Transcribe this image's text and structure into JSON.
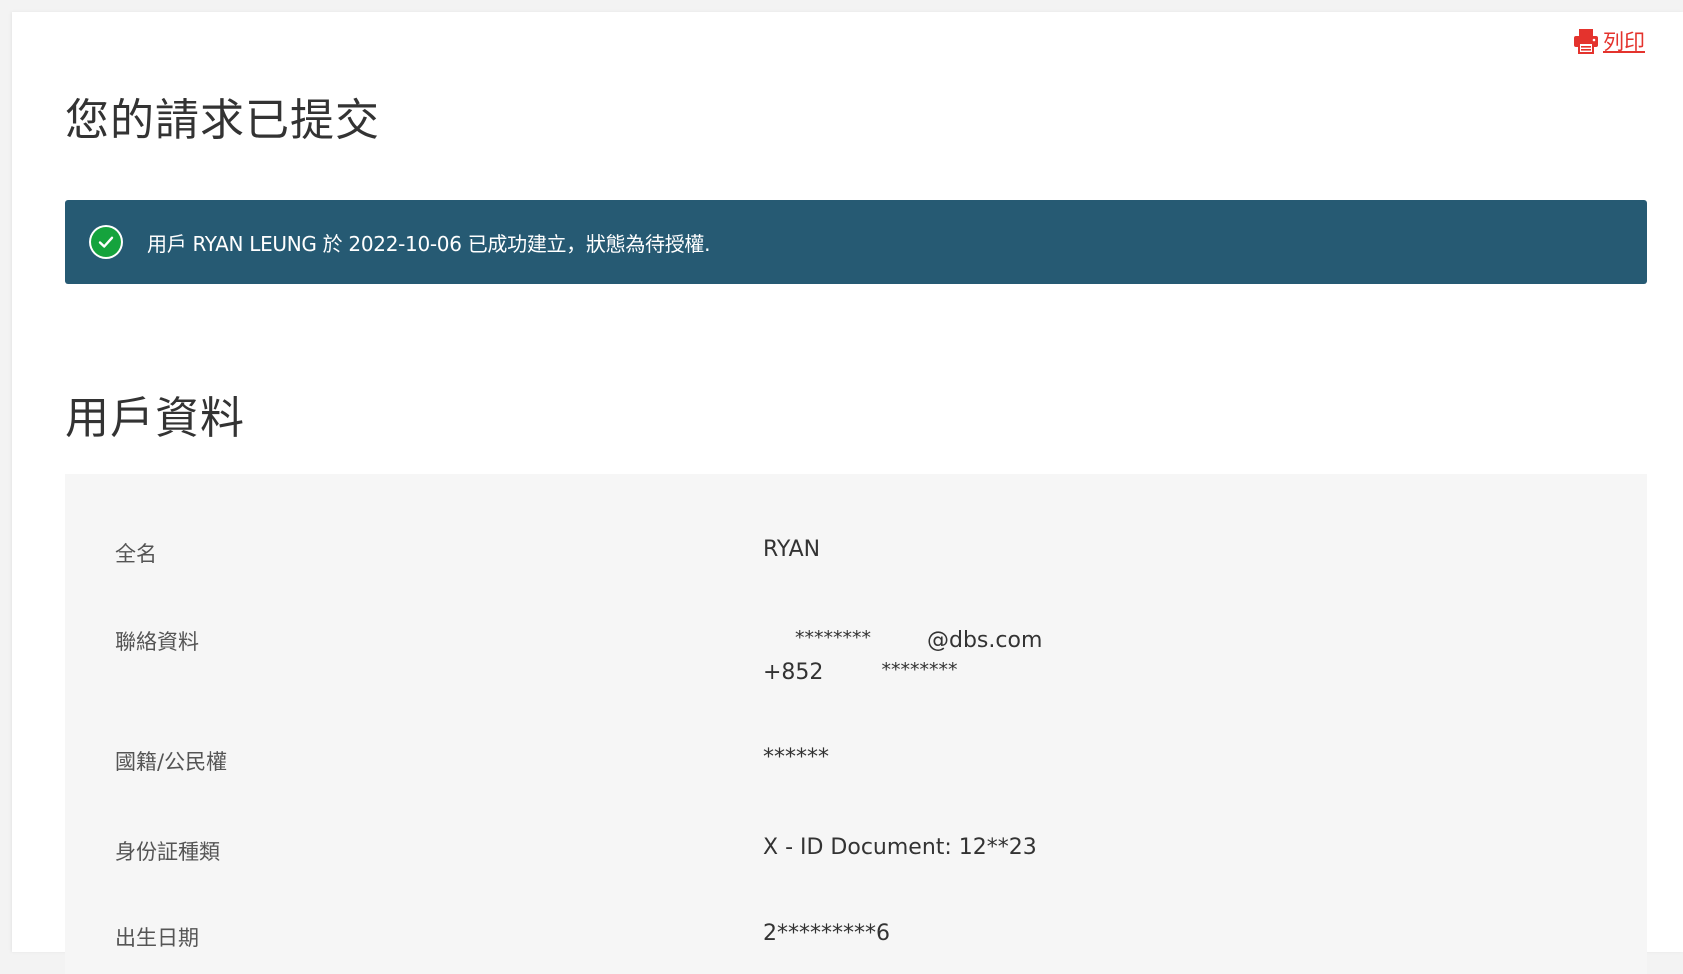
{
  "header": {
    "print_label": "列印"
  },
  "page": {
    "title": "您的請求已提交"
  },
  "banner": {
    "message": "用戶 RYAN LEUNG 於 2022-10-06 已成功建立，狀態為待授權."
  },
  "section": {
    "title": "用戶資料"
  },
  "user_details": {
    "rows": [
      {
        "label": "全名",
        "value": "RYAN"
      },
      {
        "label": "聯絡資料",
        "email_masked": "********",
        "email_domain": "@dbs.com",
        "phone_prefix": "+852",
        "phone_masked": "********"
      },
      {
        "label": "國籍/公民權",
        "value": "******"
      },
      {
        "label": "身份証種類",
        "value": "X - ID Document: 12**23"
      },
      {
        "label": "出生日期",
        "value": "2*********6"
      }
    ]
  },
  "colors": {
    "accent_red": "#e4332d",
    "banner_bg": "#265a73",
    "success_green": "#15a33d",
    "panel_bg": "#f6f6f6"
  },
  "icons": {
    "print": "printer-icon",
    "success": "check-circle-icon"
  }
}
